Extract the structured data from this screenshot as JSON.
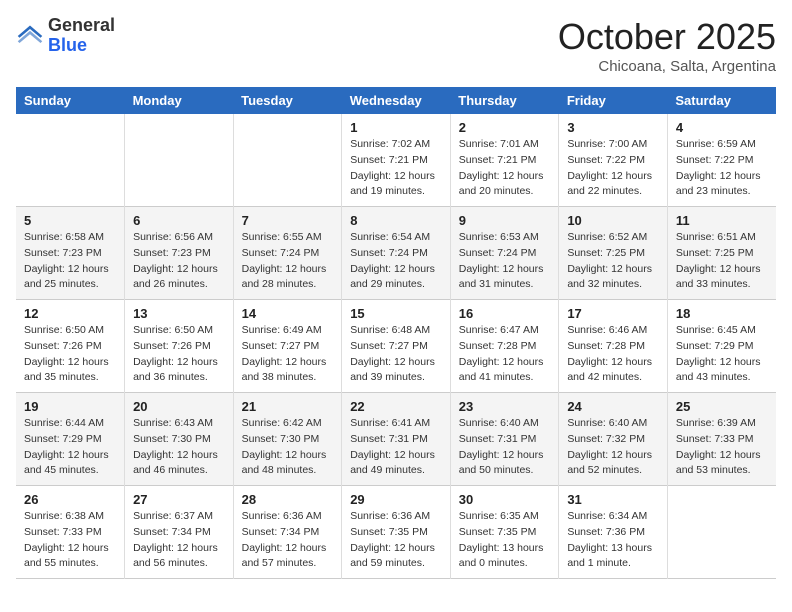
{
  "header": {
    "logo_general": "General",
    "logo_blue": "Blue",
    "title": "October 2025",
    "subtitle": "Chicoana, Salta, Argentina"
  },
  "weekdays": [
    "Sunday",
    "Monday",
    "Tuesday",
    "Wednesday",
    "Thursday",
    "Friday",
    "Saturday"
  ],
  "weeks": [
    [
      {
        "day": "",
        "info": ""
      },
      {
        "day": "",
        "info": ""
      },
      {
        "day": "",
        "info": ""
      },
      {
        "day": "1",
        "info": "Sunrise: 7:02 AM\nSunset: 7:21 PM\nDaylight: 12 hours\nand 19 minutes."
      },
      {
        "day": "2",
        "info": "Sunrise: 7:01 AM\nSunset: 7:21 PM\nDaylight: 12 hours\nand 20 minutes."
      },
      {
        "day": "3",
        "info": "Sunrise: 7:00 AM\nSunset: 7:22 PM\nDaylight: 12 hours\nand 22 minutes."
      },
      {
        "day": "4",
        "info": "Sunrise: 6:59 AM\nSunset: 7:22 PM\nDaylight: 12 hours\nand 23 minutes."
      }
    ],
    [
      {
        "day": "5",
        "info": "Sunrise: 6:58 AM\nSunset: 7:23 PM\nDaylight: 12 hours\nand 25 minutes."
      },
      {
        "day": "6",
        "info": "Sunrise: 6:56 AM\nSunset: 7:23 PM\nDaylight: 12 hours\nand 26 minutes."
      },
      {
        "day": "7",
        "info": "Sunrise: 6:55 AM\nSunset: 7:24 PM\nDaylight: 12 hours\nand 28 minutes."
      },
      {
        "day": "8",
        "info": "Sunrise: 6:54 AM\nSunset: 7:24 PM\nDaylight: 12 hours\nand 29 minutes."
      },
      {
        "day": "9",
        "info": "Sunrise: 6:53 AM\nSunset: 7:24 PM\nDaylight: 12 hours\nand 31 minutes."
      },
      {
        "day": "10",
        "info": "Sunrise: 6:52 AM\nSunset: 7:25 PM\nDaylight: 12 hours\nand 32 minutes."
      },
      {
        "day": "11",
        "info": "Sunrise: 6:51 AM\nSunset: 7:25 PM\nDaylight: 12 hours\nand 33 minutes."
      }
    ],
    [
      {
        "day": "12",
        "info": "Sunrise: 6:50 AM\nSunset: 7:26 PM\nDaylight: 12 hours\nand 35 minutes."
      },
      {
        "day": "13",
        "info": "Sunrise: 6:50 AM\nSunset: 7:26 PM\nDaylight: 12 hours\nand 36 minutes."
      },
      {
        "day": "14",
        "info": "Sunrise: 6:49 AM\nSunset: 7:27 PM\nDaylight: 12 hours\nand 38 minutes."
      },
      {
        "day": "15",
        "info": "Sunrise: 6:48 AM\nSunset: 7:27 PM\nDaylight: 12 hours\nand 39 minutes."
      },
      {
        "day": "16",
        "info": "Sunrise: 6:47 AM\nSunset: 7:28 PM\nDaylight: 12 hours\nand 41 minutes."
      },
      {
        "day": "17",
        "info": "Sunrise: 6:46 AM\nSunset: 7:28 PM\nDaylight: 12 hours\nand 42 minutes."
      },
      {
        "day": "18",
        "info": "Sunrise: 6:45 AM\nSunset: 7:29 PM\nDaylight: 12 hours\nand 43 minutes."
      }
    ],
    [
      {
        "day": "19",
        "info": "Sunrise: 6:44 AM\nSunset: 7:29 PM\nDaylight: 12 hours\nand 45 minutes."
      },
      {
        "day": "20",
        "info": "Sunrise: 6:43 AM\nSunset: 7:30 PM\nDaylight: 12 hours\nand 46 minutes."
      },
      {
        "day": "21",
        "info": "Sunrise: 6:42 AM\nSunset: 7:30 PM\nDaylight: 12 hours\nand 48 minutes."
      },
      {
        "day": "22",
        "info": "Sunrise: 6:41 AM\nSunset: 7:31 PM\nDaylight: 12 hours\nand 49 minutes."
      },
      {
        "day": "23",
        "info": "Sunrise: 6:40 AM\nSunset: 7:31 PM\nDaylight: 12 hours\nand 50 minutes."
      },
      {
        "day": "24",
        "info": "Sunrise: 6:40 AM\nSunset: 7:32 PM\nDaylight: 12 hours\nand 52 minutes."
      },
      {
        "day": "25",
        "info": "Sunrise: 6:39 AM\nSunset: 7:33 PM\nDaylight: 12 hours\nand 53 minutes."
      }
    ],
    [
      {
        "day": "26",
        "info": "Sunrise: 6:38 AM\nSunset: 7:33 PM\nDaylight: 12 hours\nand 55 minutes."
      },
      {
        "day": "27",
        "info": "Sunrise: 6:37 AM\nSunset: 7:34 PM\nDaylight: 12 hours\nand 56 minutes."
      },
      {
        "day": "28",
        "info": "Sunrise: 6:36 AM\nSunset: 7:34 PM\nDaylight: 12 hours\nand 57 minutes."
      },
      {
        "day": "29",
        "info": "Sunrise: 6:36 AM\nSunset: 7:35 PM\nDaylight: 12 hours\nand 59 minutes."
      },
      {
        "day": "30",
        "info": "Sunrise: 6:35 AM\nSunset: 7:35 PM\nDaylight: 13 hours\nand 0 minutes."
      },
      {
        "day": "31",
        "info": "Sunrise: 6:34 AM\nSunset: 7:36 PM\nDaylight: 13 hours\nand 1 minute."
      },
      {
        "day": "",
        "info": ""
      }
    ]
  ]
}
